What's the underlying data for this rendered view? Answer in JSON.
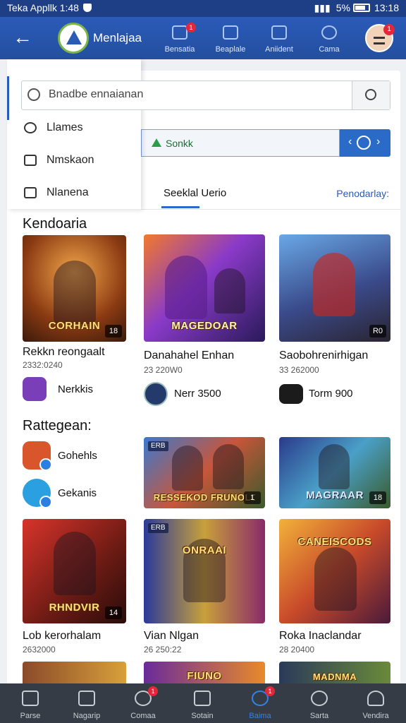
{
  "status_bar": {
    "left_text": "Teka Appllk 1:48",
    "battery": "5%",
    "time": "13:18"
  },
  "header": {
    "app_title": "Menlajaa",
    "nav": [
      {
        "label": "Bensatia",
        "icon": "inbox-icon",
        "badge": "1"
      },
      {
        "label": "Beaplale",
        "icon": "document-icon",
        "badge": ""
      },
      {
        "label": "Aniident",
        "icon": "puzzle-icon",
        "badge": ""
      },
      {
        "label": "Cama",
        "icon": "search-icon",
        "badge": ""
      }
    ],
    "avatar_badge": "1"
  },
  "search": {
    "placeholder": "Bnadbe ennaianan"
  },
  "drawer": {
    "items": [
      {
        "label": "Llames",
        "icon": "gamepad-icon"
      },
      {
        "label": "Nmskaon",
        "icon": "store-icon"
      },
      {
        "label": "Nlanena",
        "icon": "home-icon"
      }
    ]
  },
  "filter": {
    "label": "Sonkk",
    "button_icon": "refresh-icon"
  },
  "tabs": {
    "active": "Seeklal Uerio",
    "link": "Penodarlay:"
  },
  "sections": {
    "featured": "Kendoaria",
    "categories": "Rattegean:"
  },
  "featured_games": [
    {
      "title": "Rekkn reongaalt",
      "sub": "2332:0240",
      "art_title": "CORHAIN",
      "rating": "18"
    },
    {
      "title": "Danahahel Enhan",
      "sub": "23 220W0",
      "art_title": "MAGEDOAR",
      "rating": ""
    },
    {
      "title": "Saobohrenirhigan",
      "sub": "33 262000",
      "art_title": "",
      "rating": "R0"
    }
  ],
  "publishers": [
    {
      "name": "Nerkkis",
      "color": "#7a3fb8"
    },
    {
      "name": "Nerr 3500",
      "color": "#243a6a"
    },
    {
      "name": "Torm 900",
      "color": "#1b1b1b"
    }
  ],
  "categories": [
    {
      "name": "Gohehls",
      "color": "#d9562c"
    },
    {
      "name": "Gekanis",
      "color": "#2aa0e0"
    }
  ],
  "mid_games": [
    {
      "art_title": "RESSEKOD FRUNOLO",
      "tag": "ERB",
      "rating": "1"
    },
    {
      "art_title": "MAGRAAR",
      "tag": "",
      "rating": "18"
    }
  ],
  "more_games": [
    {
      "title": "Lob kerorhalam",
      "sub": "2632000",
      "art_title": "RHNDVIR",
      "rating": "14"
    },
    {
      "title": "Vian Nlgan",
      "sub": "26 250:22",
      "art_title": "ONRAAI",
      "rating": "",
      "tag": "ERB"
    },
    {
      "title": "Roka Inaclandar",
      "sub": "28 20400",
      "art_title": "CANEISCODS",
      "rating": ""
    }
  ],
  "bottom_row": [
    {
      "art_title": ""
    },
    {
      "art_title": "FIUNO"
    },
    {
      "art_title": "MADNMA"
    }
  ],
  "bottom_nav": [
    {
      "label": "Parse",
      "icon": "home-icon",
      "badge": ""
    },
    {
      "label": "Nagarip",
      "icon": "compass-icon",
      "badge": ""
    },
    {
      "label": "Comaa",
      "icon": "chat-icon",
      "badge": "1"
    },
    {
      "label": "Sotain",
      "icon": "library-icon",
      "badge": ""
    },
    {
      "label": "Baima",
      "icon": "discover-icon",
      "badge": "1",
      "active": true
    },
    {
      "label": "Sarta",
      "icon": "search-icon",
      "badge": ""
    },
    {
      "label": "Vendira",
      "icon": "profile-icon",
      "badge": ""
    }
  ],
  "colors": {
    "header": "#2a5bb8",
    "accent": "#2a6bc8",
    "bottom_nav": "#363c45",
    "badge": "#e0283a"
  }
}
